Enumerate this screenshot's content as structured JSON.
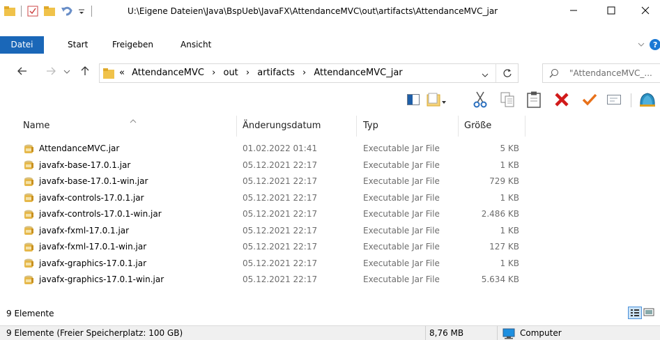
{
  "window": {
    "title": "U:\\Eigene Dateien\\Java\\BspUeb\\JavaFX\\AttendanceMVC\\out\\artifacts\\AttendanceMVC_jar"
  },
  "ribbon": {
    "tabs": [
      "Datei",
      "Start",
      "Freigeben",
      "Ansicht"
    ]
  },
  "address": {
    "overflow": "«",
    "crumbs": [
      "AttendanceMVC",
      "out",
      "artifacts",
      "AttendanceMVC_jar"
    ],
    "separator": "›"
  },
  "search": {
    "placeholder": "\"AttendanceMVC_..."
  },
  "columns": {
    "name": "Name",
    "date": "Änderungsdatum",
    "type": "Typ",
    "size": "Größe"
  },
  "files": [
    {
      "name": "AttendanceMVC.jar",
      "date": "01.02.2022 01:41",
      "type": "Executable Jar File",
      "size": "5 KB"
    },
    {
      "name": "javafx-base-17.0.1.jar",
      "date": "05.12.2021 22:17",
      "type": "Executable Jar File",
      "size": "1 KB"
    },
    {
      "name": "javafx-base-17.0.1-win.jar",
      "date": "05.12.2021 22:17",
      "type": "Executable Jar File",
      "size": "729 KB"
    },
    {
      "name": "javafx-controls-17.0.1.jar",
      "date": "05.12.2021 22:17",
      "type": "Executable Jar File",
      "size": "1 KB"
    },
    {
      "name": "javafx-controls-17.0.1-win.jar",
      "date": "05.12.2021 22:17",
      "type": "Executable Jar File",
      "size": "2.486 KB"
    },
    {
      "name": "javafx-fxml-17.0.1.jar",
      "date": "05.12.2021 22:17",
      "type": "Executable Jar File",
      "size": "1 KB"
    },
    {
      "name": "javafx-fxml-17.0.1-win.jar",
      "date": "05.12.2021 22:17",
      "type": "Executable Jar File",
      "size": "127 KB"
    },
    {
      "name": "javafx-graphics-17.0.1.jar",
      "date": "05.12.2021 22:17",
      "type": "Executable Jar File",
      "size": "1 KB"
    },
    {
      "name": "javafx-graphics-17.0.1-win.jar",
      "date": "05.12.2021 22:17",
      "type": "Executable Jar File",
      "size": "5.634 KB"
    }
  ],
  "item_count": "9 Elemente",
  "statusbar": {
    "left": "9 Elemente (Freier Speicherplatz: 100 GB)",
    "size": "8,76 MB",
    "location": "Computer"
  },
  "colors": {
    "accent": "#1a67b8",
    "folder": "#f0c24a",
    "delete": "#d11a1a",
    "check": "#e8711a"
  },
  "icons": [
    "folder-icon",
    "checkbox-icon",
    "undo-icon",
    "minimize-icon",
    "maximize-icon",
    "close-icon",
    "help-icon",
    "back-icon",
    "forward-icon",
    "up-icon",
    "refresh-icon",
    "search-icon",
    "preview-pane-icon",
    "new-folder-icon",
    "cut-icon",
    "copy-icon",
    "paste-icon",
    "delete-icon",
    "check-icon",
    "rename-icon",
    "shell-icon",
    "jar-icon",
    "computer-icon"
  ]
}
